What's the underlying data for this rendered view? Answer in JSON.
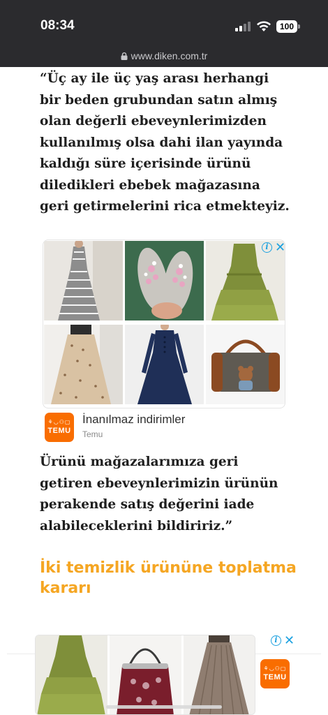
{
  "status_bar": {
    "time": "08:34",
    "battery": "100"
  },
  "browser": {
    "url": "www.diken.com.tr"
  },
  "article": {
    "paragraph_1": "“Üç ay ile üç yaş arası herhangi bir beden grubundan satın almış olan değerli ebeveynlerimizden kullanılmış olsa dahi ilan yayında kaldığı süre içerisinde ürünü diledikleri ebebek mağazasına geri getirmelerini rica etmekteyiz.",
    "paragraph_2": "Ürünü mağazalarımıza geri getiren ebeveynlerimizin ürünün perakende satış değerini iade alabileceklerini bildiririz.”",
    "subheading": "İki temizlik ürününe toplatma kararı"
  },
  "ad_1": {
    "adchoices_icon": "info-icon",
    "close_icon": "close-icon",
    "products": [
      "striped dress",
      "jeweled sandals",
      "green tiered dress",
      "floral midi skirt",
      "navy long dress",
      "duffle bag"
    ],
    "brand_logo_text": "TEMU",
    "title": "İnanılmaz indirimler",
    "advertiser": "Temu"
  },
  "ad_2": {
    "adchoices_icon": "info-icon",
    "close_icon": "close-icon",
    "products": [
      "green tiered dress",
      "beaded evening bag",
      "tulle skirt"
    ],
    "brand_logo_text": "TEMU"
  },
  "colors": {
    "heading_accent": "#f5a623",
    "temu_orange": "#f96d00",
    "adchoices_blue": "#1ca1e0",
    "status_bar_bg": "#2b2b2e"
  }
}
